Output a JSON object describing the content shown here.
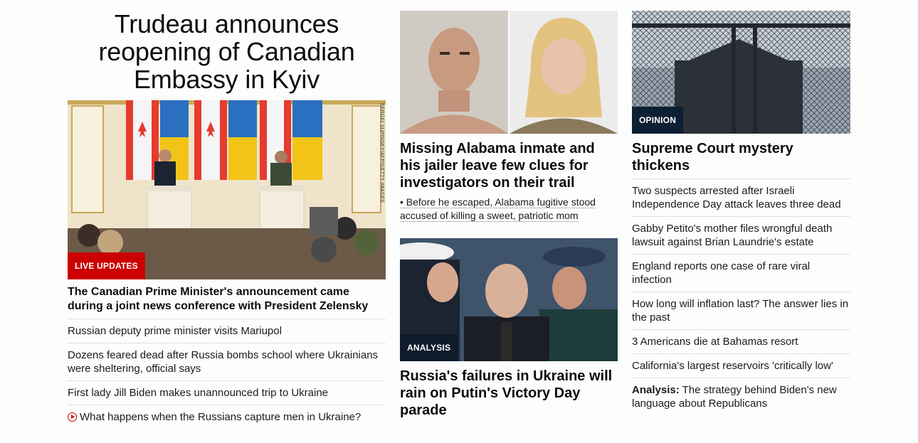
{
  "left": {
    "title": "Trudeau announces reopening of Canadian Embassy in Kyiv",
    "photo_credit": "SERGEI SUPINSKY/AFP/GETTY IMAGES",
    "badge": "LIVE UPDATES",
    "subheadline": "The Canadian Prime Minister's announcement came during a joint news conference with President Zelensky",
    "links": [
      "Russian deputy prime minister visits Mariupol",
      "Dozens feared dead after Russia bombs school where Ukrainians were sheltering, official says",
      "First lady Jill Biden makes unannounced trip to Ukraine",
      "What happens when the Russians capture men in Ukraine?"
    ]
  },
  "middle": {
    "story1": {
      "title": "Missing Alabama inmate and his jailer leave few clues for investigators on their trail",
      "bullet": "• Before he escaped, Alabama fugitive stood accused of killing a sweet, patriotic mom"
    },
    "story2": {
      "badge": "ANALYSIS",
      "title": "Russia's failures in Ukraine will rain on Putin's Victory Day parade"
    }
  },
  "right": {
    "badge": "OPINION",
    "title": "Supreme Court mystery thickens",
    "links": [
      "Two suspects arrested after Israeli Independence Day attack leaves three dead",
      "Gabby Petito's mother files wrongful death lawsuit against Brian Laundrie's estate",
      "England reports one case of rare viral infection",
      "How long will inflation last? The answer lies in the past",
      "3 Americans die at Bahamas resort",
      "California's largest reservoirs 'critically low'"
    ],
    "analysis_prefix": "Analysis:",
    "analysis_text": " The strategy behind Biden's new language about Republicans"
  },
  "colors": {
    "badge_red": "#cc0000",
    "badge_dark": "#0d1b2a",
    "divider": "#e0e0e0"
  }
}
